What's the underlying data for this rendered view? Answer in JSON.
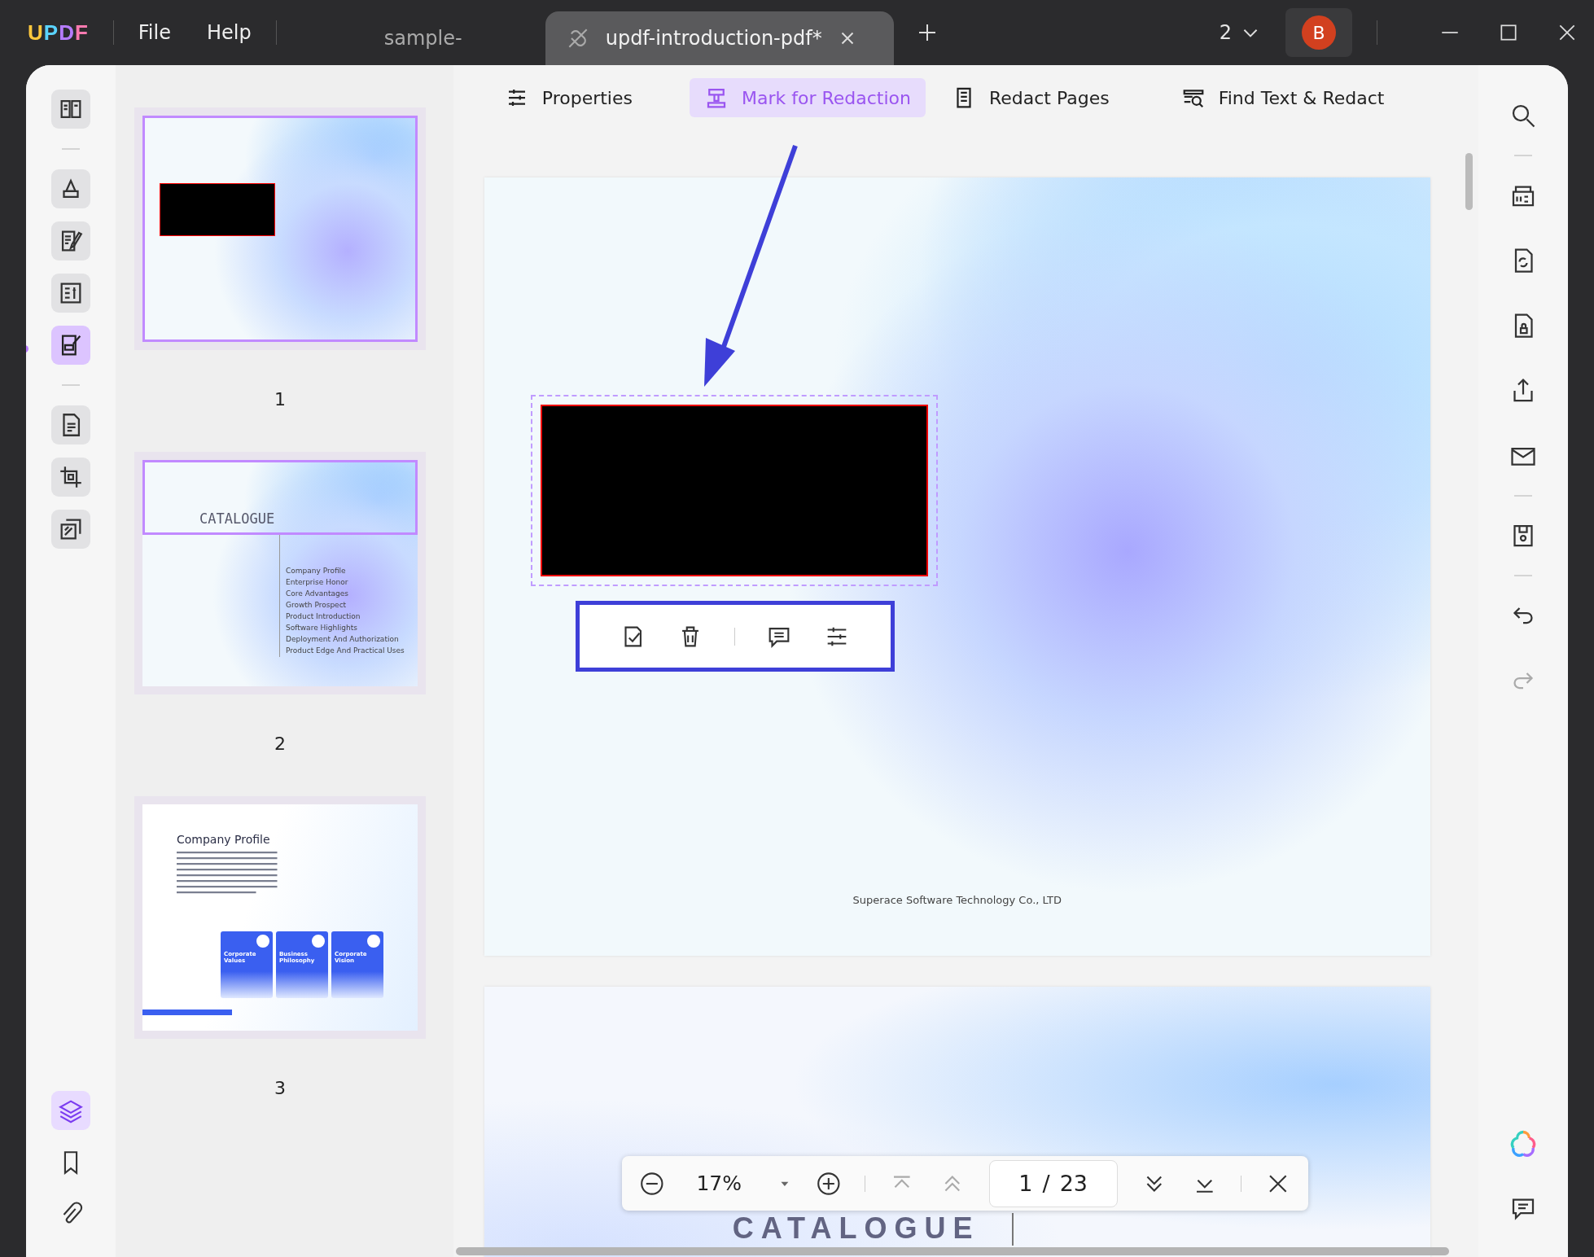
{
  "app": {
    "logo": "UPDF",
    "menu": [
      "File",
      "Help"
    ]
  },
  "tabs": [
    {
      "label": "sample-",
      "selected": false
    },
    {
      "label": "updf-introduction-pdf*",
      "selected": true
    }
  ],
  "window_count": "2",
  "avatar": "B",
  "left_tools": [
    {
      "kind": "reader",
      "selected": false
    },
    {
      "kind": "divider"
    },
    {
      "kind": "highlighter",
      "selected": false
    },
    {
      "kind": "edit",
      "selected": false
    },
    {
      "kind": "form",
      "selected": false
    },
    {
      "kind": "redact",
      "selected": true
    },
    {
      "kind": "divider"
    },
    {
      "kind": "pages",
      "selected": false
    },
    {
      "kind": "crop",
      "selected": false
    },
    {
      "kind": "stack",
      "selected": false
    }
  ],
  "left_bottom_tools": [
    {
      "kind": "layers",
      "selected": true
    },
    {
      "kind": "bookmark",
      "selected": false
    },
    {
      "kind": "clip",
      "selected": false
    }
  ],
  "redact_toolbar": [
    {
      "kind": "sliders",
      "label": "Properties",
      "selected": false
    },
    {
      "kind": "mark",
      "label": "Mark for Redaction",
      "selected": true
    },
    {
      "kind": "pagelist",
      "label": "Redact Pages",
      "selected": false
    },
    {
      "kind": "findtext",
      "label": "Find Text & Redact",
      "selected": false
    }
  ],
  "thumbnails": [
    {
      "page": "1",
      "kind": "cover",
      "selected": true,
      "view_frame": false
    },
    {
      "page": "2",
      "kind": "catalogue",
      "selected": false,
      "view_frame": true,
      "heading": "CATALOGUE",
      "items": [
        "Company Profile",
        "Enterprise Honor",
        "Core Advantages",
        "Growth Prospect",
        "Product Introduction",
        "Software Highlights",
        "Deployment And Authorization",
        "Product Edge And Practical Uses"
      ]
    },
    {
      "page": "3",
      "kind": "profile",
      "selected": false,
      "view_frame": false,
      "heading": "Company Profile",
      "cards": [
        "Corporate Values",
        "Business Philosophy",
        "Corporate Vision"
      ]
    }
  ],
  "document": {
    "footer": "Superace Software Technology Co., LTD",
    "next_page_heading": "CATALOGUE",
    "mark_tools": [
      {
        "kind": "apply"
      },
      {
        "kind": "delete"
      },
      {
        "kind": "comment"
      },
      {
        "kind": "properties"
      }
    ]
  },
  "zoom_bar": {
    "zoom": "17%",
    "page": "1",
    "separator": "/",
    "total": "23"
  },
  "right_tools": [
    {
      "kind": "search"
    },
    {
      "kind": "divider"
    },
    {
      "kind": "ocr"
    },
    {
      "kind": "convert"
    },
    {
      "kind": "protect"
    },
    {
      "kind": "share"
    },
    {
      "kind": "mail"
    },
    {
      "kind": "divider"
    },
    {
      "kind": "save"
    },
    {
      "kind": "divider"
    },
    {
      "kind": "undo"
    },
    {
      "kind": "redo"
    }
  ],
  "right_bottom_tools": [
    {
      "kind": "ai"
    },
    {
      "kind": "comments"
    }
  ]
}
